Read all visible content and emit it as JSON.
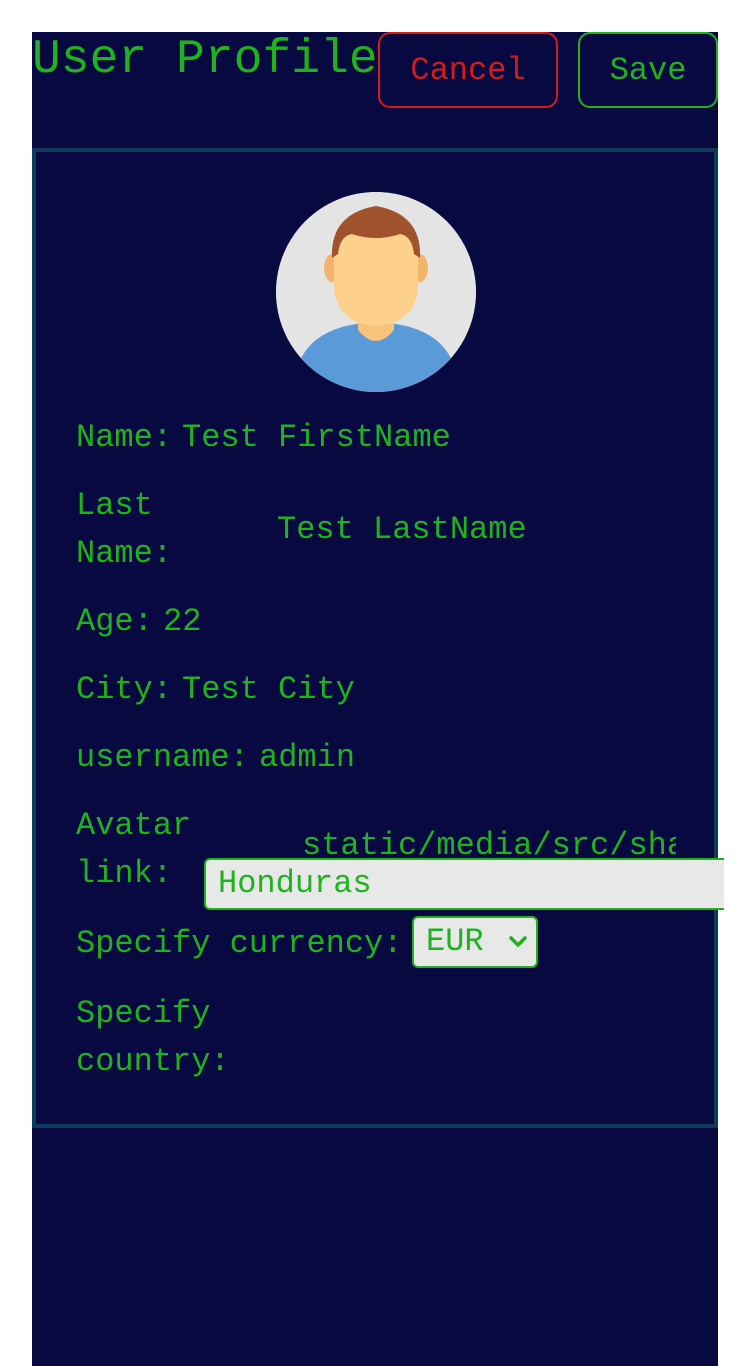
{
  "header": {
    "title": "User Profile",
    "cancel_label": "Cancel",
    "save_label": "Save"
  },
  "profile": {
    "name_label": "Name:",
    "name_value": "Test FirstName",
    "last_name_label": "Last Name:",
    "last_name_value": "Test LastName",
    "age_label": "Age:",
    "age_value": "22",
    "city_label": "City:",
    "city_value": "Test City",
    "username_label": "username:",
    "username_value": "admin",
    "avatar_link_label": "Avatar link:",
    "avatar_link_value": "static/media/src/sha",
    "currency_label": "Specify currency:",
    "currency_value": "EUR",
    "country_label": "Specify country:",
    "country_value": "Honduras"
  },
  "icons": {
    "avatar": "user-avatar-icon",
    "currency_dropdown": "chevron-down-icon"
  },
  "colors": {
    "background": "#070940",
    "text_green": "#1db31d",
    "cancel_red": "#d41a1a",
    "card_border": "#0b3c5a"
  }
}
